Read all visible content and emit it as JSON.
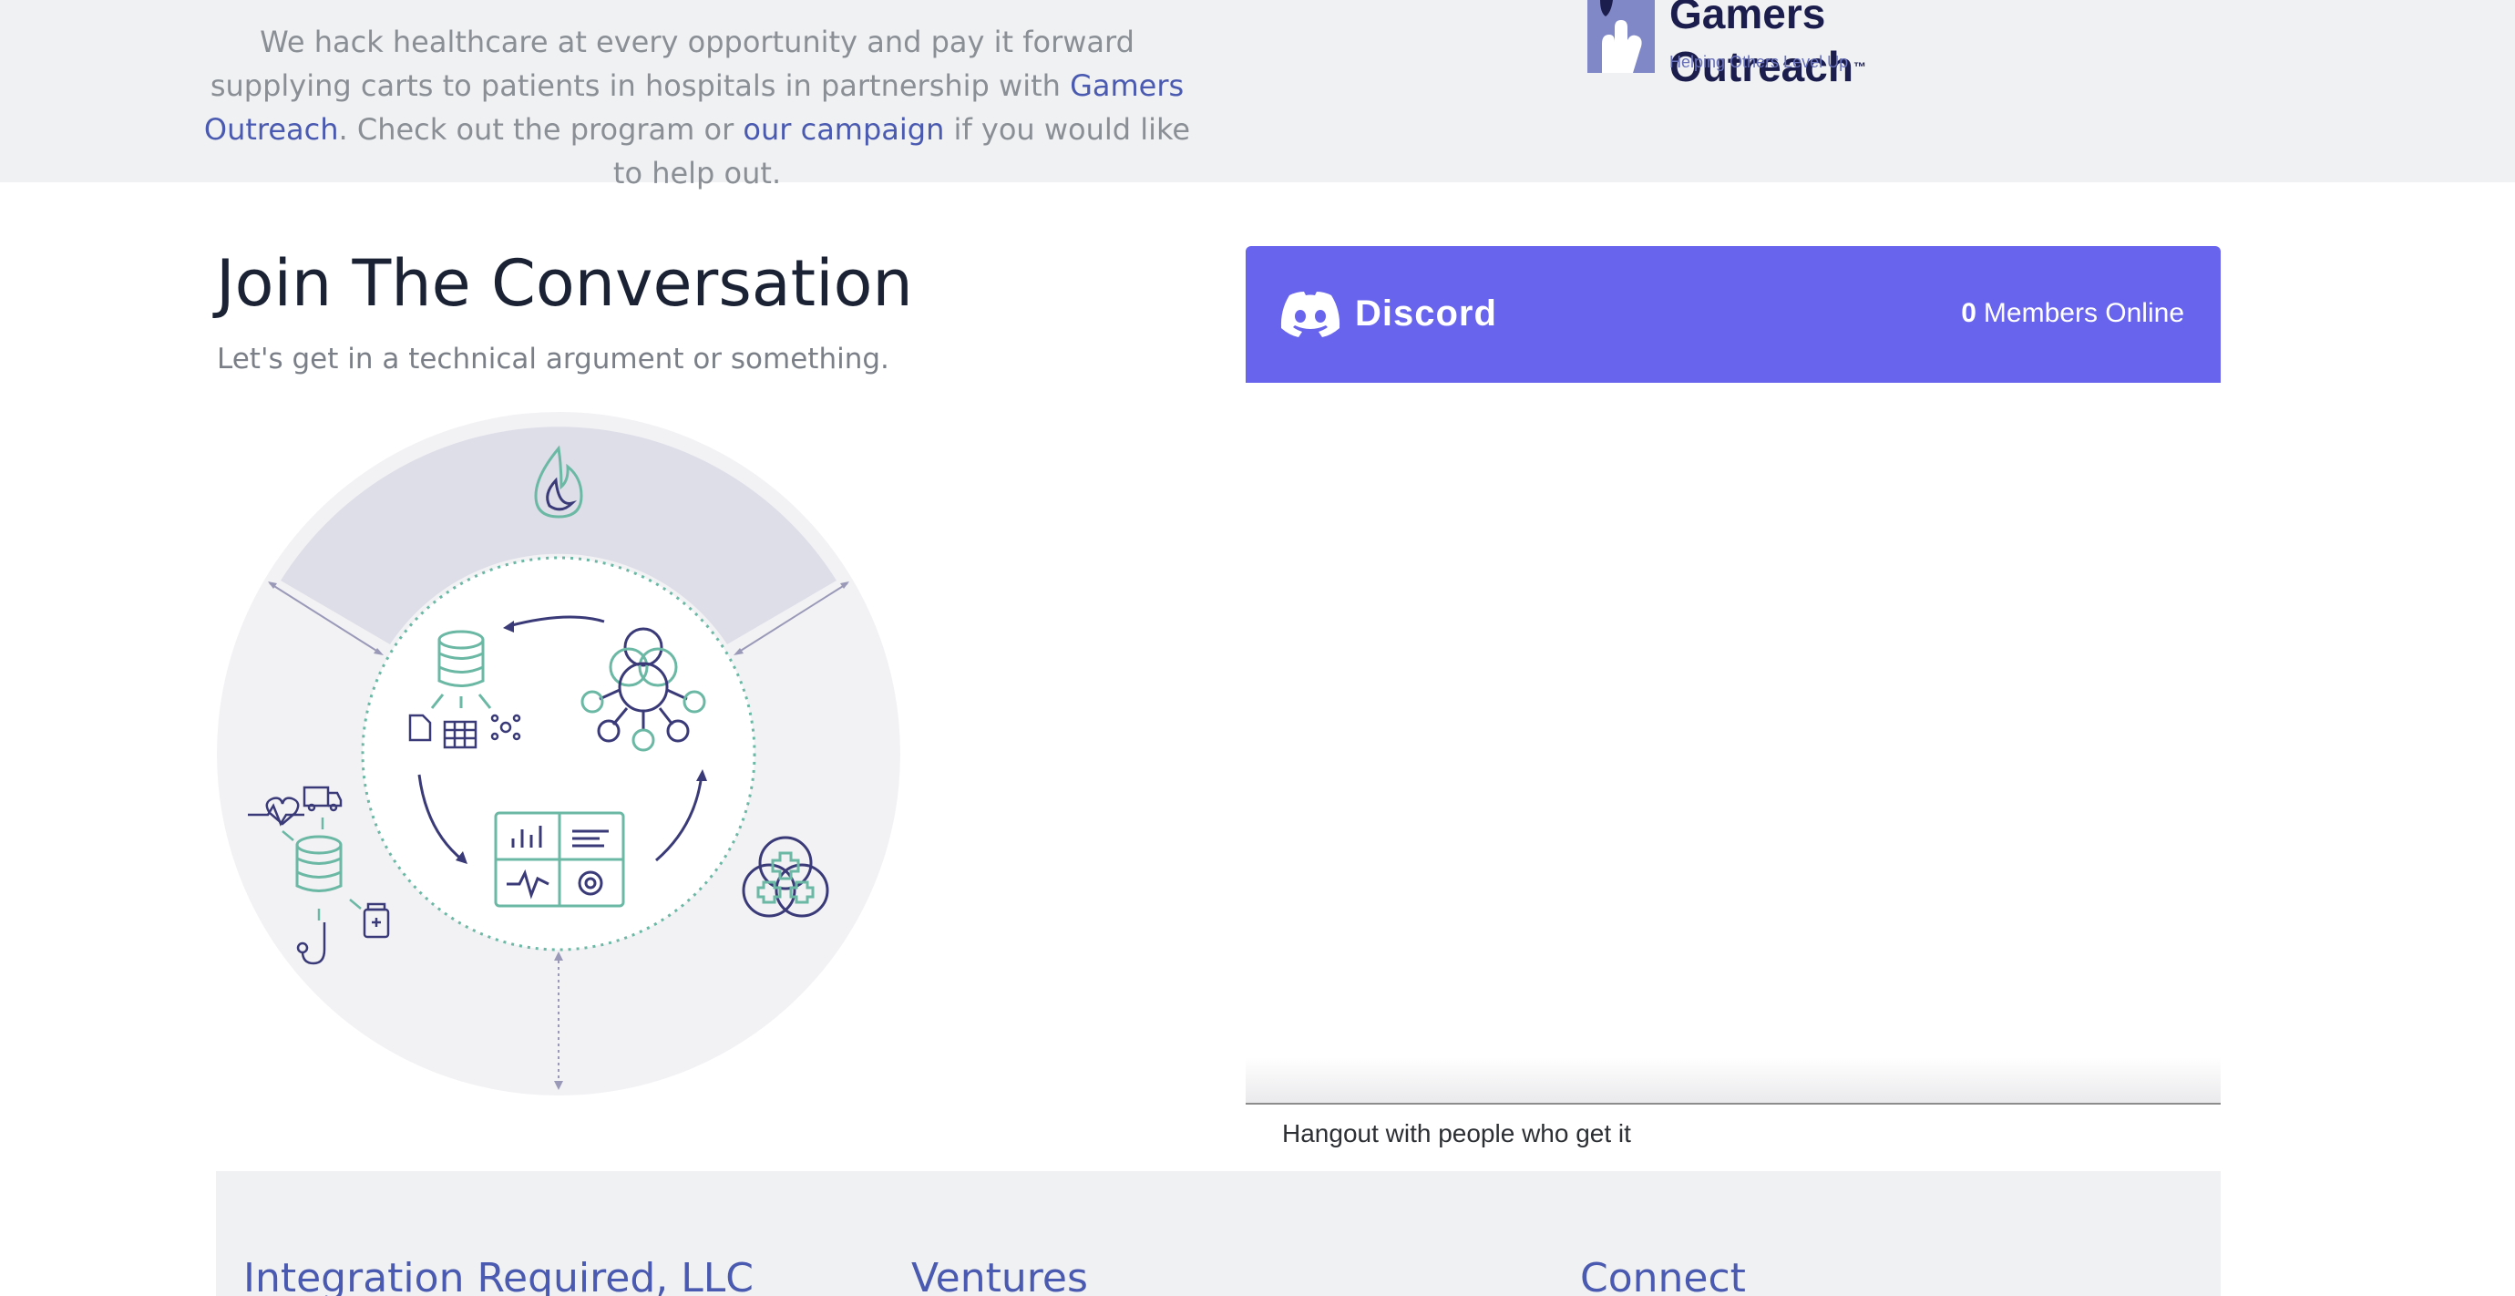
{
  "intro": {
    "text_before_link1": "We hack healthcare at every opportunity and pay it forward supplying carts to patients in hospitals in partnership with ",
    "link1": "Gamers Outreach",
    "text_between": ". Check out the program or ",
    "link2": "our campaign",
    "text_after": " if you would like to help out."
  },
  "partner": {
    "name_line1": "Gamers",
    "name_line2": "Outreach",
    "trademark": "™",
    "tagline": "Helping Others Level Up",
    "badge_color": "#8088c8"
  },
  "conversation": {
    "title": "Join The Conversation",
    "subtitle": "Let's get in a technical argument or something."
  },
  "discord": {
    "brand": "Discord",
    "online_count": "0",
    "online_label": "Members Online",
    "footer_text": "Hangout with people who get it",
    "header_color": "#6864ed"
  },
  "footer": {
    "columns": [
      "Integration Required, LLC",
      "Ventures",
      "Connect"
    ]
  },
  "illustration_icons": [
    "flame-icon",
    "database-icon",
    "document-icon",
    "grid-icon",
    "network-icon",
    "node-graph-icon",
    "dashboard-icon",
    "heart-rate-icon",
    "ambulance-icon",
    "stethoscope-icon",
    "medicine-bottle-icon",
    "medical-cross-icon"
  ]
}
